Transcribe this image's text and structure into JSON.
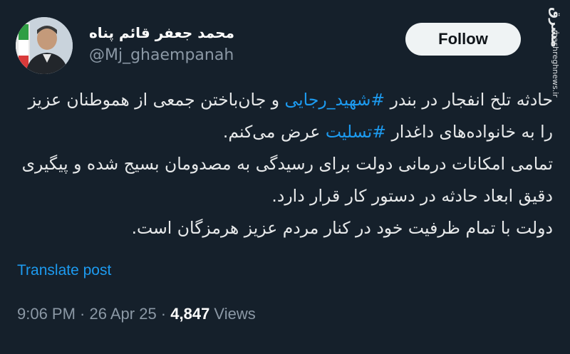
{
  "author": {
    "display_name": "محمد جعفر قائم پناه",
    "handle": "@Mj_ghaempanah",
    "avatar_icon": "profile-photo"
  },
  "follow_button": {
    "label": "Follow"
  },
  "watermark": {
    "logo": "مشرق",
    "site": "mashreghnews.ir"
  },
  "tweet": {
    "p1_pre": "حادثه تلخ انفجار در بندر ",
    "p1_tag1": "#شهید_رجایی",
    "p1_mid": " و جان‌باختن جمعی از هموطنان عزیز را به خانواده‌های داغدار ",
    "p1_tag2": "#تسلیت",
    "p1_post": " عرض می‌کنم.",
    "p2": "تمامی امکانات درمانی دولت برای رسیدگی به مصدومان بسیج شده و پیگیری دقیق ابعاد حادثه در دستور کار قرار دارد.",
    "p3": "دولت با تمام ظرفیت خود در کنار مردم عزیز هرمزگان است."
  },
  "translate_link": "Translate post",
  "meta": {
    "time": "9:06 PM",
    "sep1": " · ",
    "date": "26 Apr 25",
    "sep2": " · ",
    "views_count": "4,847",
    "views_label": " Views"
  },
  "colors": {
    "background": "#15202b",
    "link": "#1d9bf0",
    "secondary_text": "#8b98a5"
  }
}
